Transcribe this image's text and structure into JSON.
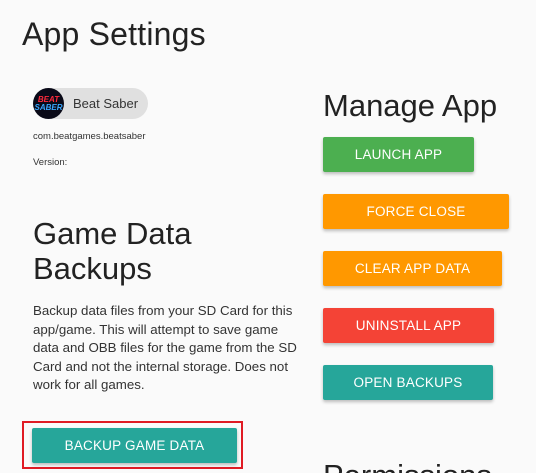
{
  "page": {
    "title": "App Settings"
  },
  "app": {
    "name": "Beat Saber",
    "icon_line1": "BEAT",
    "icon_line2": "SABER",
    "package": "com.beatgames.beatsaber",
    "version_label": "Version:"
  },
  "backups": {
    "title": "Game Data Backups",
    "description": "Backup data files from your SD Card for this app/game. This will attempt to save game data and OBB files for the game from the SD Card and not the internal storage. Does not work for all games.",
    "backup_button": "BACKUP GAME DATA"
  },
  "manage": {
    "title": "Manage App",
    "launch": "LAUNCH APP",
    "force_close": "FORCE CLOSE",
    "clear_data": "CLEAR APP DATA",
    "uninstall": "UNINSTALL APP",
    "open_backups": "OPEN BACKUPS"
  },
  "permissions": {
    "title": "Permissions"
  },
  "colors": {
    "green": "#4caf50",
    "orange": "#ff9800",
    "red": "#f44336",
    "teal": "#26a69a",
    "highlight": "#e01b24"
  }
}
